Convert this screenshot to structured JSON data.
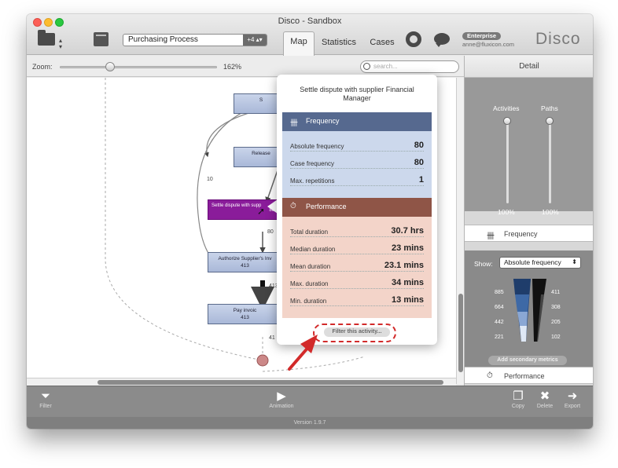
{
  "window": {
    "title": "Disco - Sandbox"
  },
  "toolbar": {
    "project": "Purchasing Process",
    "project_badge": "+4 ▴▾",
    "tabs": [
      "Map",
      "Statistics",
      "Cases"
    ],
    "enterprise_badge": "Enterprise",
    "user_email": "anne@fluxicon.com",
    "logo": "Disco"
  },
  "zoom": {
    "label": "Zoom:",
    "value": "162%",
    "level_fraction": 0.3
  },
  "search": {
    "placeholder": "search..."
  },
  "map": {
    "nodes": [
      "S",
      "Release",
      "Authorize Supplier's Inv",
      "Pay invoic"
    ],
    "node_counts": [
      "413",
      "413"
    ],
    "highlighted": {
      "label": "Settle dispute with supp",
      "count": "80"
    },
    "edge_labels": [
      "10",
      "80",
      "413",
      "41"
    ]
  },
  "popover": {
    "title": "Settle dispute with supplier Financial Manager",
    "frequency": {
      "header": "Frequency",
      "rows": [
        {
          "label": "Absolute frequency",
          "value": "80"
        },
        {
          "label": "Case frequency",
          "value": "80"
        },
        {
          "label": "Max. repetitions",
          "value": "1"
        }
      ]
    },
    "performance": {
      "header": "Performance",
      "rows": [
        {
          "label": "Total duration",
          "value": "30.7 hrs"
        },
        {
          "label": "Median duration",
          "value": "23 mins"
        },
        {
          "label": "Mean duration",
          "value": "23.1 mins"
        },
        {
          "label": "Max. duration",
          "value": "34 mins"
        },
        {
          "label": "Min. duration",
          "value": "13 mins"
        }
      ]
    },
    "filter_button": "Filter this activity..."
  },
  "detail": {
    "header": "Detail",
    "activities_label": "Activities",
    "paths_label": "Paths",
    "activities_value": "100%",
    "paths_value": "100%",
    "frequency_section": "Frequency",
    "show_label": "Show:",
    "show_value": "Absolute frequency",
    "left_scale": [
      "885",
      "664",
      "442",
      "221"
    ],
    "right_scale": [
      "411",
      "308",
      "205",
      "102"
    ],
    "add_metrics": "Add secondary metrics",
    "performance_section": "Performance"
  },
  "bottom": {
    "filter": "Filter",
    "animation": "Animation",
    "copy": "Copy",
    "delete": "Delete",
    "export": "Export"
  },
  "status": {
    "version": "Version 1.9.7"
  },
  "colors": {
    "freq_header": "#56698f",
    "perf_header": "#8f5547",
    "highlight_node": "#8a1c9a",
    "annotation": "#d22a2a"
  }
}
